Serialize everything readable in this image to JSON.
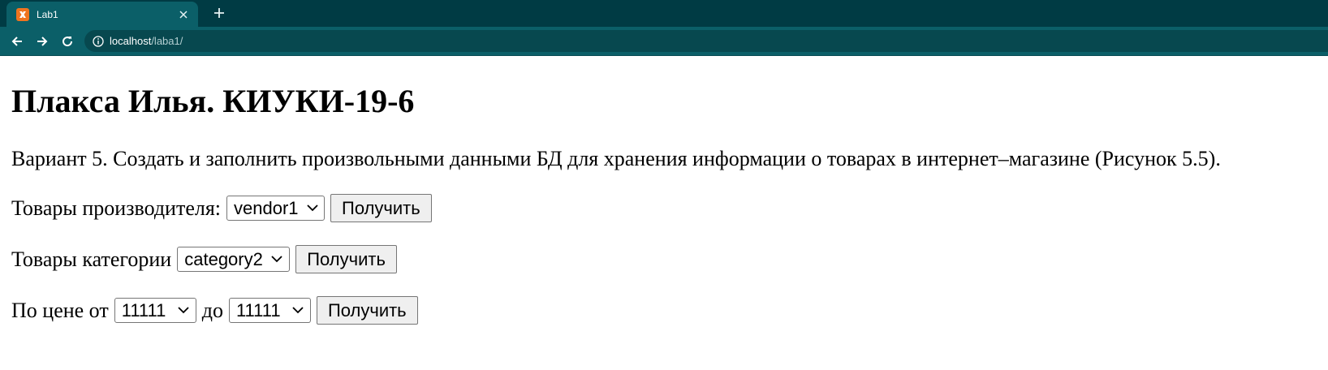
{
  "browser": {
    "tab_title": "Lab1",
    "favicon_glyph": "Ꞡ",
    "url_host": "localhost",
    "url_path": "/laba1/"
  },
  "page": {
    "heading": "Плакса Илья. КИУКИ-19-6",
    "description": "Вариант 5. Создать и заполнить произвольными данными БД для хранения информации о товарах в интернет–магазине (Рисунок 5.5).",
    "vendor_row": {
      "label": "Товары производителя:",
      "selected": "vendor1",
      "button": "Получить"
    },
    "category_row": {
      "label": "Товары категории",
      "selected": "category2",
      "button": "Получить"
    },
    "price_row": {
      "label_from": "По цене от",
      "from_selected": "11111",
      "label_to": "до",
      "to_selected": "11111",
      "button": "Получить"
    }
  }
}
